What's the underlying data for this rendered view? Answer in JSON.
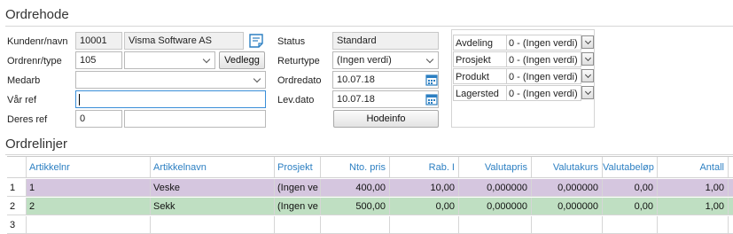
{
  "header": {
    "section_title": "Ordrehode",
    "customer_label": "Kundenr/navn",
    "customer_no": "10001",
    "customer_name": "Visma Software AS",
    "order_label": "Ordrenr/type",
    "order_no": "105",
    "order_type": "",
    "vedlegg_button": "Vedlegg",
    "medarb_label": "Medarb",
    "medarb_value": "",
    "var_ref_label": "Vår ref",
    "var_ref_value": "",
    "deres_ref_label": "Deres ref",
    "deres_ref_no": "0",
    "deres_ref_name": "",
    "status_label": "Status",
    "status_value": "Standard",
    "returtype_label": "Returtype",
    "returtype_value": "(Ingen verdi)",
    "ordredato_label": "Ordredato",
    "ordredato_value": "10.07.18",
    "levdato_label": "Lev.dato",
    "levdato_value": "10.07.18",
    "hodeinfo_button": "Hodeinfo",
    "dimensions": [
      {
        "label": "Avdeling",
        "value": "0 - (Ingen verdi)"
      },
      {
        "label": "Prosjekt",
        "value": "0 - (Ingen verdi)"
      },
      {
        "label": "Produkt",
        "value": "0 - (Ingen verdi)"
      },
      {
        "label": "Lagersted",
        "value": "0 - (Ingen verdi)"
      }
    ]
  },
  "lines": {
    "section_title": "Ordrelinjer",
    "columns": [
      "Artikkelnr",
      "Artikkelnavn",
      "Prosjekt",
      "Nto. pris",
      "Rab. I",
      "Valutapris",
      "Valutakurs",
      "Valutabeløp",
      "Antall"
    ],
    "rows": [
      {
        "no": "1",
        "cells": [
          "1",
          "Veske",
          "(Ingen ve",
          "400,00",
          "10,00",
          "0,000000",
          "0,000000",
          "0,00",
          "1,00"
        ]
      },
      {
        "no": "2",
        "cells": [
          "2",
          "Sekk",
          "(Ingen ve",
          "500,00",
          "0,00",
          "0,000000",
          "0,000000",
          "0,00",
          "1,00"
        ]
      },
      {
        "no": "3",
        "cells": [
          "",
          "",
          "",
          "",
          "",
          "",
          "",
          "",
          ""
        ]
      }
    ]
  },
  "colors": {
    "row_highlight": "#d5c6df",
    "row_selected": "#bfdfc2",
    "header_text": "#2c7fc2",
    "focus_border": "#3a8ed8"
  },
  "icons": [
    "notes-icon",
    "calendar-icon",
    "chevron-down-icon"
  ]
}
